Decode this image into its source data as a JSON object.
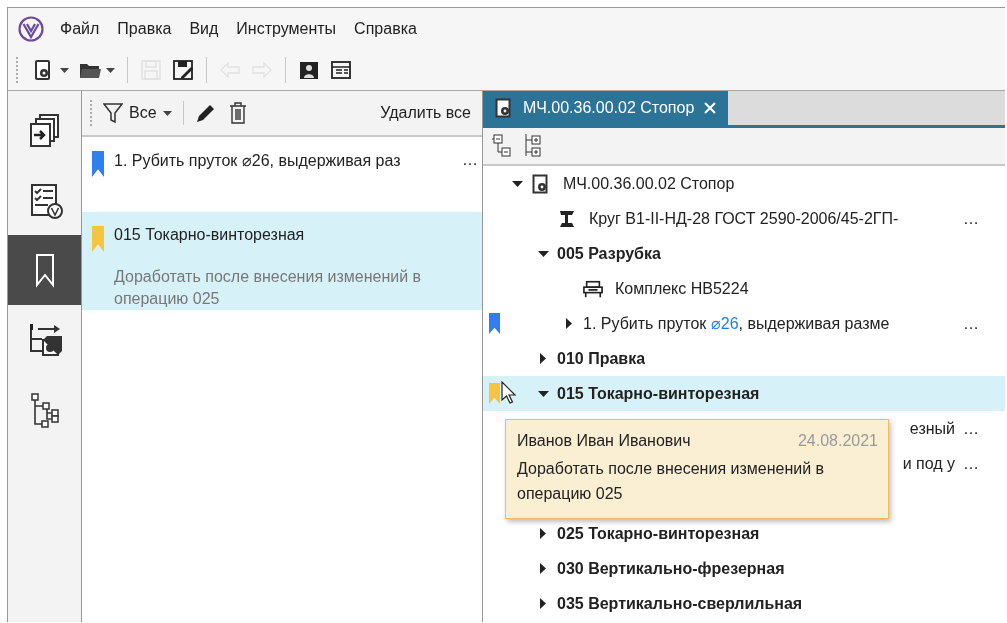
{
  "menu": [
    "Файл",
    "Правка",
    "Вид",
    "Инструменты",
    "Справка"
  ],
  "toolbar": [
    [
      {
        "kind": "new",
        "dropdown": true,
        "disabled": false
      },
      {
        "kind": "open",
        "dropdown": true,
        "disabled": false
      }
    ],
    [
      {
        "kind": "save",
        "dropdown": false,
        "disabled": true
      },
      {
        "kind": "save-as",
        "dropdown": false,
        "disabled": false
      }
    ],
    [
      {
        "kind": "undo",
        "dropdown": false,
        "disabled": true
      },
      {
        "kind": "redo",
        "dropdown": false,
        "disabled": true
      }
    ],
    [
      {
        "kind": "report",
        "dropdown": false,
        "disabled": false
      },
      {
        "kind": "window",
        "dropdown": false,
        "disabled": false
      }
    ]
  ],
  "sidebar": [
    {
      "kind": "processes",
      "selected": false
    },
    {
      "kind": "checklist",
      "selected": false
    },
    {
      "kind": "bookmarks",
      "selected": true
    },
    {
      "kind": "export",
      "selected": false
    },
    {
      "kind": "structure",
      "selected": false
    }
  ],
  "notes_panel": {
    "filter": "Все",
    "delete_all": "Удалить все",
    "items": [
      {
        "color": "#2f7ff0",
        "title": "1. Рубить пруток ⌀26, выдерживая раз",
        "ellipsis": "…",
        "selected": false
      },
      {
        "color": "#f5c542",
        "title": "015 Токарно-винторезная",
        "note": "Доработать после внесения изменений в операцию 025",
        "selected": true
      }
    ]
  },
  "tab": {
    "title": "МЧ.00.36.00.02 Стопор",
    "selected": true
  },
  "tree": [
    {
      "kind": "document",
      "text": "МЧ.00.36.00.02 Стопор",
      "expanded": true,
      "selected": false,
      "children": [
        {
          "kind": "material",
          "text": "Круг В1-II-НД-28 ГОСТ 2590-2006/45-2ГП-",
          "ellipsis": "…",
          "selected": false
        },
        {
          "kind": "operation",
          "text": "005 Разрубка",
          "expanded": true,
          "selected": false,
          "children": [
            {
              "kind": "equipment",
              "text": "Комплекс НВ5224",
              "selected": false
            },
            {
              "kind": "step",
              "parts": [
                {
                  "text": "1. Рубить пруток ",
                  "highlight": false
                },
                {
                  "text": "⌀26",
                  "highlight": true
                },
                {
                  "text": ", выдерживая разме",
                  "highlight": false
                }
              ],
              "ellipsis": "…",
              "expanded": false,
              "color": "#2f7ff0",
              "selected": false
            }
          ]
        },
        {
          "kind": "operation",
          "text": "010 Правка",
          "expanded": false,
          "selected": false
        },
        {
          "kind": "operation",
          "text": "015 Токарно-винторезная",
          "expanded": true,
          "color": "#f5c542",
          "selected": true,
          "children": [
            {
              "kind": "covered",
              "text": "езный",
              "ellipsis": "…",
              "selected": false
            },
            {
              "kind": "covered",
              "text": "и под у",
              "ellipsis": "…",
              "selected": false
            },
            {
              "kind": "covered",
              "selected": false
            }
          ]
        },
        {
          "kind": "operation",
          "text": "025 Токарно-винторезная",
          "expanded": false,
          "selected": false
        },
        {
          "kind": "operation",
          "text": "030 Вертикально-фрезерная",
          "expanded": false,
          "selected": false
        },
        {
          "kind": "operation",
          "text": "035 Вертикально-сверлильная",
          "expanded": false,
          "selected": false
        }
      ]
    }
  ],
  "tooltip": {
    "author": "Иванов Иван Иванович",
    "date": "24.08.2021",
    "text": "Доработать после внесения изменений в операцию 025"
  }
}
